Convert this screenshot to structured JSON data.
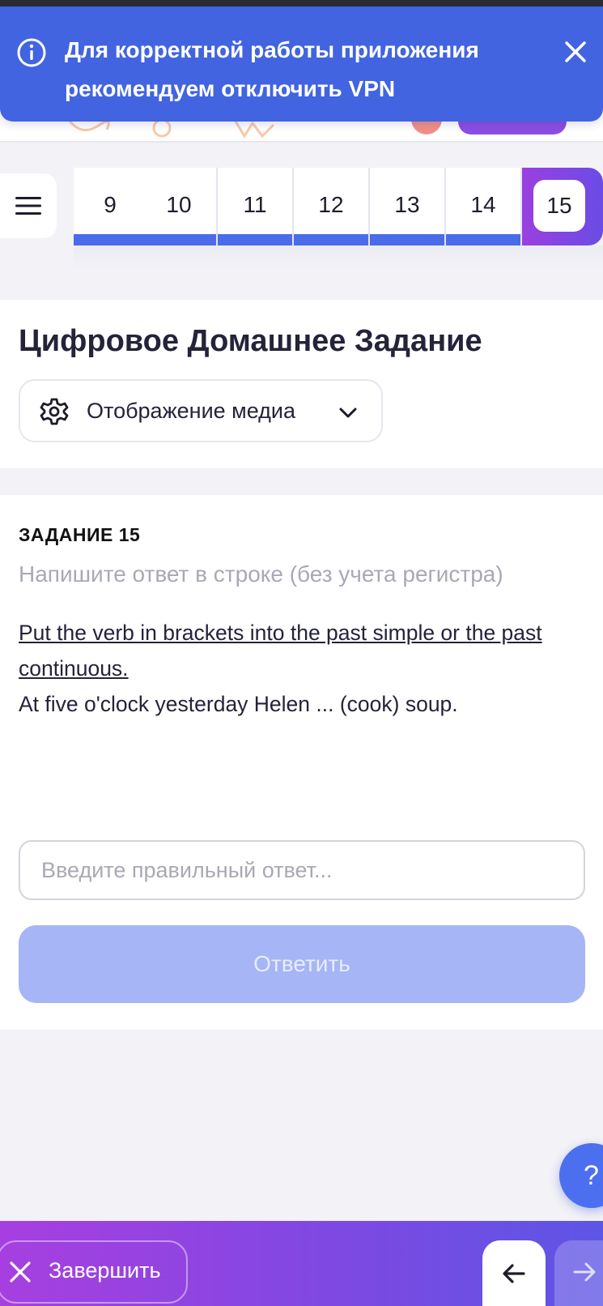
{
  "banner": {
    "message": "Для корректной работы приложения рекомендуем отключить VPN",
    "icon": "info-icon",
    "close_icon": "close-icon",
    "color": "#4264e0"
  },
  "navigation": {
    "menu_icon": "hamburger-menu-icon",
    "steps": [
      {
        "label": "9",
        "answered": true
      },
      {
        "label": "10",
        "answered": true
      },
      {
        "label": "11",
        "answered": true
      },
      {
        "label": "12",
        "answered": true
      },
      {
        "label": "13",
        "answered": true
      },
      {
        "label": "14",
        "answered": true
      },
      {
        "label": "15",
        "active": true
      }
    ]
  },
  "header": {
    "title": "Цифровое Домашнее Задание",
    "media_button": {
      "label": "Отображение медиа",
      "icon": "gear-icon",
      "chevron": "chevron-down-icon"
    }
  },
  "task": {
    "label": "ЗАДАНИЕ 15",
    "hint": "Напишите ответ в строке (без учета регистра)",
    "instruction": "Put the verb in brackets into the past simple or the past continuous.",
    "question": "At five o'clock yesterday Helen ... (cook) soup.",
    "answer": {
      "value": "",
      "placeholder": "Введите правильный ответ..."
    },
    "submit_label": "Ответить"
  },
  "help": {
    "label": "?"
  },
  "footer": {
    "finish_label": "Завершить",
    "finish_icon": "close-icon",
    "prev_icon": "arrow-left-icon",
    "next_icon": "arrow-right-icon"
  },
  "colors": {
    "accent": "#4b6ce8",
    "gradient_start": "#a73fe0",
    "gradient_end": "#5d55e6",
    "submit_disabled": "#a5b5f6"
  }
}
